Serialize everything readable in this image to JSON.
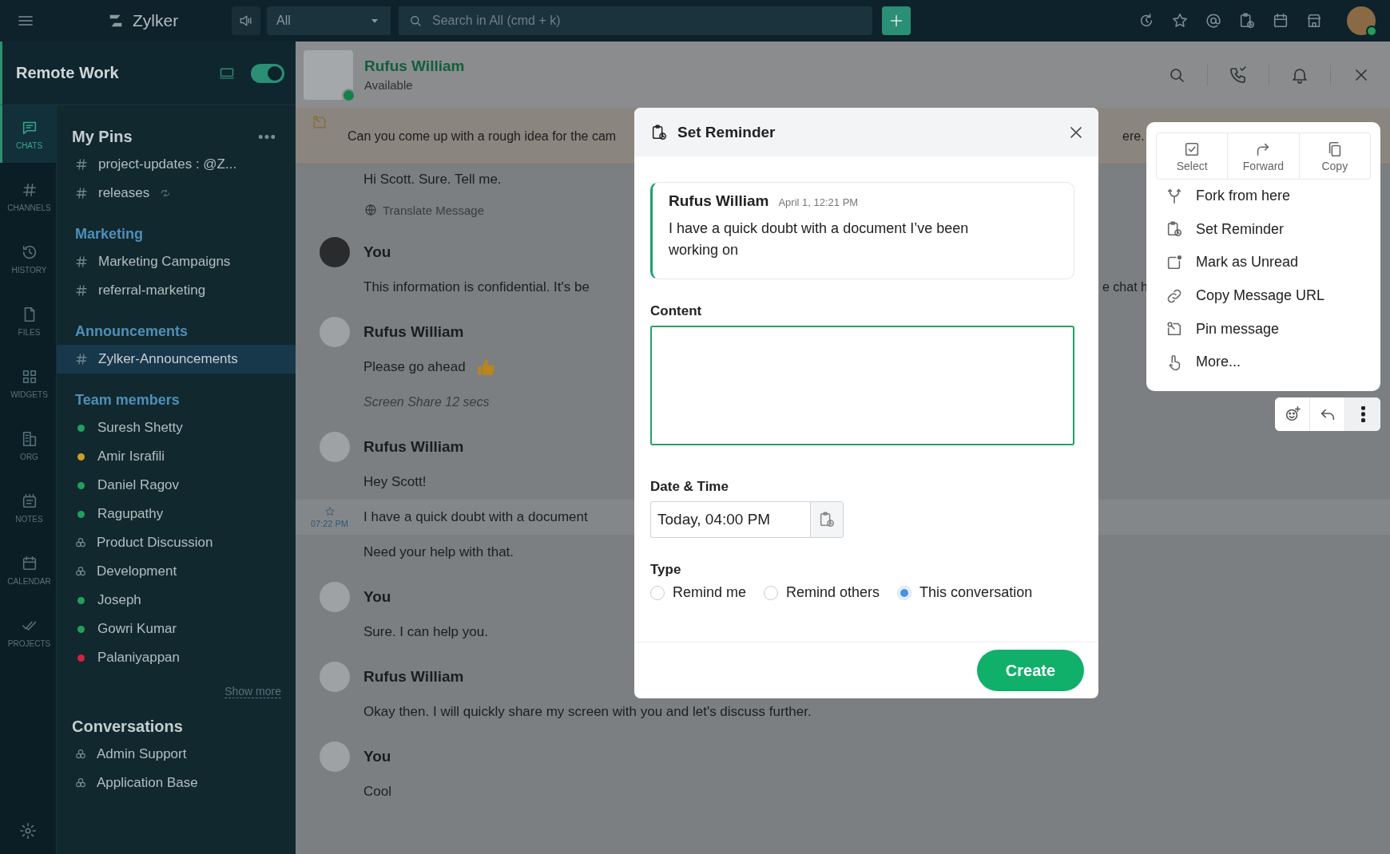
{
  "topbar": {
    "app_name": "Zylker",
    "scope": "All",
    "search": {
      "placeholder": "Search in All (cmd + k)"
    }
  },
  "workspace": {
    "name": "Remote Work",
    "toggle_on": true
  },
  "rail": [
    {
      "label": "CHATS",
      "selected": true
    },
    {
      "label": "CHANNELS",
      "selected": false
    },
    {
      "label": "HISTORY",
      "selected": false
    },
    {
      "label": "FILES",
      "selected": false
    },
    {
      "label": "WIDGETS",
      "selected": false
    },
    {
      "label": "ORG",
      "selected": false
    },
    {
      "label": "NOTES",
      "selected": false
    },
    {
      "label": "CALENDAR",
      "selected": false
    },
    {
      "label": "PROJECTS",
      "selected": false
    }
  ],
  "sidebar": {
    "groups": [
      {
        "title": "My Pins",
        "kind": "main",
        "has_menu": true,
        "items": [
          {
            "label": "project-updates : @Z...",
            "kind": "channel",
            "selected": false,
            "synced": false
          },
          {
            "label": "releases",
            "kind": "channel",
            "selected": false,
            "synced": true
          }
        ]
      },
      {
        "title": "Marketing",
        "kind": "category",
        "has_menu": false,
        "items": [
          {
            "label": "Marketing Campaigns",
            "kind": "channel",
            "selected": false,
            "synced": false
          },
          {
            "label": "referral-marketing",
            "kind": "channel",
            "selected": false,
            "synced": false
          }
        ]
      },
      {
        "title": "Announcements",
        "kind": "category",
        "has_menu": false,
        "items": [
          {
            "label": "Zylker-Announcements",
            "kind": "channel",
            "selected": true,
            "synced": false
          }
        ]
      },
      {
        "title": "Team members",
        "kind": "category",
        "has_menu": false,
        "show_more": "Show more",
        "items": [
          {
            "label": "Suresh Shetty",
            "kind": "person",
            "selected": false,
            "color": "#22a05a"
          },
          {
            "label": "Amir Israfili",
            "kind": "person",
            "selected": false,
            "color": "#c9a02c"
          },
          {
            "label": "Daniel Ragov",
            "kind": "person",
            "selected": false,
            "color": "#22a05a"
          },
          {
            "label": "Ragupathy",
            "kind": "person",
            "selected": false,
            "color": "#22a05a"
          },
          {
            "label": "Product Discussion",
            "kind": "group",
            "selected": false
          },
          {
            "label": "Development",
            "kind": "group",
            "selected": false
          },
          {
            "label": "Joseph",
            "kind": "person",
            "selected": false,
            "color": "#22a05a"
          },
          {
            "label": "Gowri Kumar",
            "kind": "person",
            "selected": false,
            "color": "#22a05a"
          },
          {
            "label": "Palaniyappan",
            "kind": "person",
            "selected": false,
            "color": "#d0243e"
          }
        ]
      },
      {
        "title": "Conversations",
        "kind": "main",
        "has_menu": false,
        "items": [
          {
            "label": "Admin Support",
            "kind": "group",
            "selected": false
          },
          {
            "label": "Application Base",
            "kind": "group",
            "selected": false
          }
        ]
      }
    ]
  },
  "chat": {
    "contact": {
      "name": "Rufus William",
      "status": "Available",
      "online": true
    },
    "pinned": {
      "text": "Can you come up with a rough idea for the cam",
      "text_right": "ere."
    },
    "messages": [
      {
        "lines": [
          {
            "kind": "text",
            "text": "Hi Scott. Sure. Tell me."
          },
          {
            "kind": "translate",
            "text": "Translate Message"
          }
        ]
      },
      {
        "sender": "You",
        "lines": [
          {
            "kind": "text",
            "text": "This information is confidential. It's be",
            "text_right": "e chat h"
          }
        ]
      },
      {
        "sender": "Rufus William",
        "lines": [
          {
            "kind": "text",
            "text": "Please go ahead",
            "emoji": true
          },
          {
            "kind": "meta",
            "text": "Screen Share  12 secs"
          }
        ]
      },
      {
        "sender": "Rufus William",
        "lines": [
          {
            "kind": "text",
            "text": "Hey Scott!"
          },
          {
            "kind": "text",
            "text": "I have a quick doubt with a document",
            "time": "07:22 PM",
            "starred": false,
            "highlighted": true
          },
          {
            "kind": "text",
            "text": "Need your help with that."
          }
        ]
      },
      {
        "sender": "You",
        "lines": [
          {
            "kind": "text",
            "text": "Sure. I can help you."
          }
        ]
      },
      {
        "sender": "Rufus William",
        "lines": [
          {
            "kind": "text",
            "text": "Okay then. I will quickly share my screen with you and let's discuss further."
          }
        ]
      },
      {
        "sender": "You",
        "lines": [
          {
            "kind": "text",
            "text": "Cool"
          }
        ]
      }
    ]
  },
  "reminder": {
    "title": "Set Reminder",
    "quote": {
      "sender": "Rufus William",
      "time": "April 1, 12:21 PM",
      "text": "I have a quick doubt with a document I’ve been working on"
    },
    "content_label": "Content",
    "datetime_label": "Date & Time",
    "datetime_value": "Today, 04:00 PM",
    "type_label": "Type",
    "types": [
      {
        "label": "Remind me",
        "selected": false
      },
      {
        "label": "Remind others",
        "selected": false
      },
      {
        "label": "This conversation",
        "selected": true
      }
    ],
    "create": "Create"
  },
  "menu": {
    "actions": [
      {
        "label": "Select"
      },
      {
        "label": "Forward"
      },
      {
        "label": "Copy"
      }
    ],
    "items": [
      {
        "label": "Fork from here"
      },
      {
        "label": "Set Reminder"
      },
      {
        "label": "Mark as Unread"
      },
      {
        "label": "Copy Message URL"
      },
      {
        "label": "Pin message"
      },
      {
        "label": "More..."
      }
    ],
    "toolbar": [
      {
        "active": false
      },
      {
        "active": false
      },
      {
        "active": true
      }
    ]
  }
}
